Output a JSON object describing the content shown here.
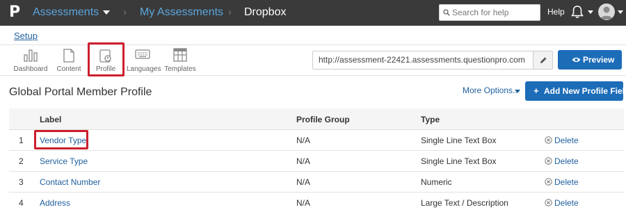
{
  "topbar": {
    "logo": "P",
    "app_menu": "Assessments",
    "breadcrumb_parent": "My Assessments",
    "breadcrumb_current": "Dropbox",
    "search_placeholder": "Search for help",
    "help": "Help"
  },
  "setup": {
    "label": "Setup"
  },
  "toolbar": {
    "dashboard": "Dashboard",
    "content": "Content",
    "profile": "Profile",
    "languages": "Languages",
    "templates": "Templates",
    "url": "http://assessment-22421.assessments.questionpro.com",
    "preview": "Preview"
  },
  "page": {
    "title": "Global Portal Member Profile",
    "more_options": "More Options..",
    "add_button": "Add New Profile Field"
  },
  "table": {
    "headers": {
      "label": "Label",
      "group": "Profile Group",
      "type": "Type"
    },
    "delete_label": "Delete",
    "rows": [
      {
        "num": "1",
        "label": "Vendor Type",
        "group": "N/A",
        "type": "Single Line Text Box"
      },
      {
        "num": "2",
        "label": "Service Type",
        "group": "N/A",
        "type": "Single Line Text Box"
      },
      {
        "num": "3",
        "label": "Contact Number",
        "group": "N/A",
        "type": "Numeric"
      },
      {
        "num": "4",
        "label": "Address",
        "group": "N/A",
        "type": "Large Text / Description"
      }
    ]
  },
  "icons": {
    "logo": "questionpro-logo-icon",
    "search": "search-icon",
    "bell": "bell-icon",
    "avatar": "user-avatar-icon",
    "dashboard": "bar-chart-icon",
    "content": "document-icon",
    "profile": "profile-card-icon",
    "languages": "keyboard-icon",
    "templates": "grid-template-icon",
    "edit": "pencil-icon",
    "preview": "eye-icon",
    "add": "plus-icon",
    "delete": "circle-x-icon"
  },
  "colors": {
    "topbar_bg": "#3a3a3a",
    "link": "#1f5f9e",
    "primary_button": "#1c6cb8",
    "highlight": "#cc1f2d"
  }
}
